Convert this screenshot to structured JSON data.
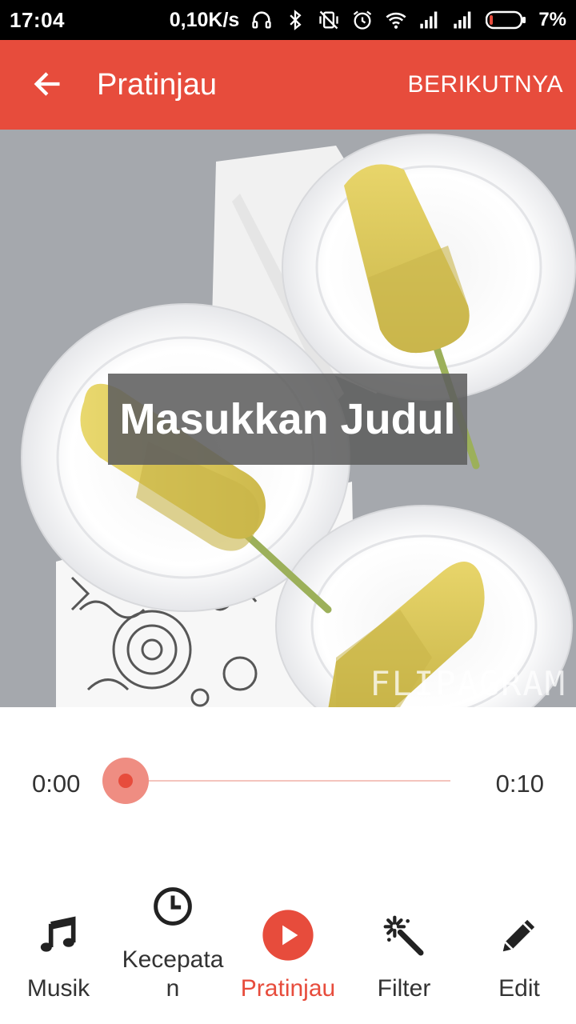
{
  "status_bar": {
    "time": "17:04",
    "network_speed": "0,10K/s",
    "battery_percent": "7%",
    "icons": [
      "headset-icon",
      "bluetooth-icon",
      "vibrate-off-icon",
      "alarm-icon",
      "wifi-icon",
      "signal-icon",
      "signal-icon",
      "battery-icon"
    ]
  },
  "app_bar": {
    "title": "Pratinjau",
    "back_icon": "arrow-left-icon",
    "next_label": "BERIKUTNYA",
    "color": "#e74c3c"
  },
  "preview": {
    "title_placeholder": "Masukkan Judul",
    "watermark": "FLIPAGRAM"
  },
  "player": {
    "current_time": "0:00",
    "total_time": "0:10",
    "progress": 0
  },
  "bottom_nav": {
    "accent_color": "#e74c3c",
    "items": [
      {
        "label": "Musik",
        "icon": "music-note-icon",
        "active": false
      },
      {
        "label": "Kecepata\nn",
        "icon": "clock-icon",
        "active": false
      },
      {
        "label": "Pratinjau",
        "icon": "play-circle-icon",
        "active": true
      },
      {
        "label": "Filter",
        "icon": "magic-wand-icon",
        "active": false
      },
      {
        "label": "Edit",
        "icon": "pencil-icon",
        "active": false
      }
    ]
  }
}
